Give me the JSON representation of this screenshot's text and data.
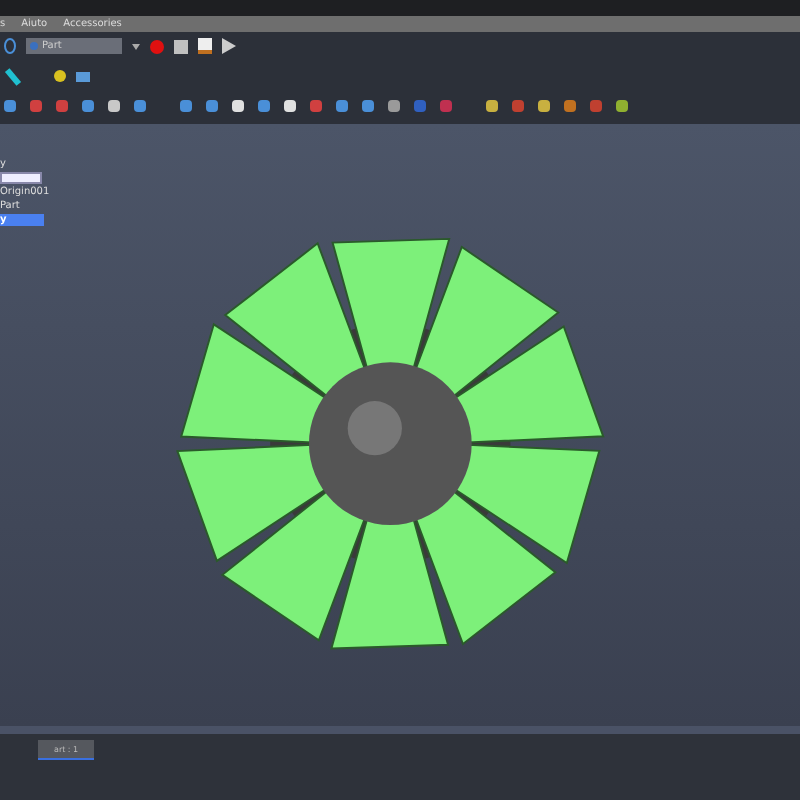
{
  "menu_bar": [
    "s",
    "Aiuto",
    "Accessories"
  ],
  "toolbar": {
    "workbench": "Part"
  },
  "tree": {
    "items": [
      {
        "label": "y",
        "selected": false,
        "kind": "item"
      },
      {
        "kind": "edit"
      },
      {
        "label": "Origin001",
        "selected": false,
        "kind": "item"
      },
      {
        "label": "Part",
        "selected": false,
        "kind": "item"
      },
      {
        "label": "y",
        "selected": true,
        "kind": "item"
      }
    ]
  },
  "viewport": {
    "kind": "model"
  },
  "document_tabs": [
    {
      "label": "art : 1",
      "selected": true
    }
  ]
}
